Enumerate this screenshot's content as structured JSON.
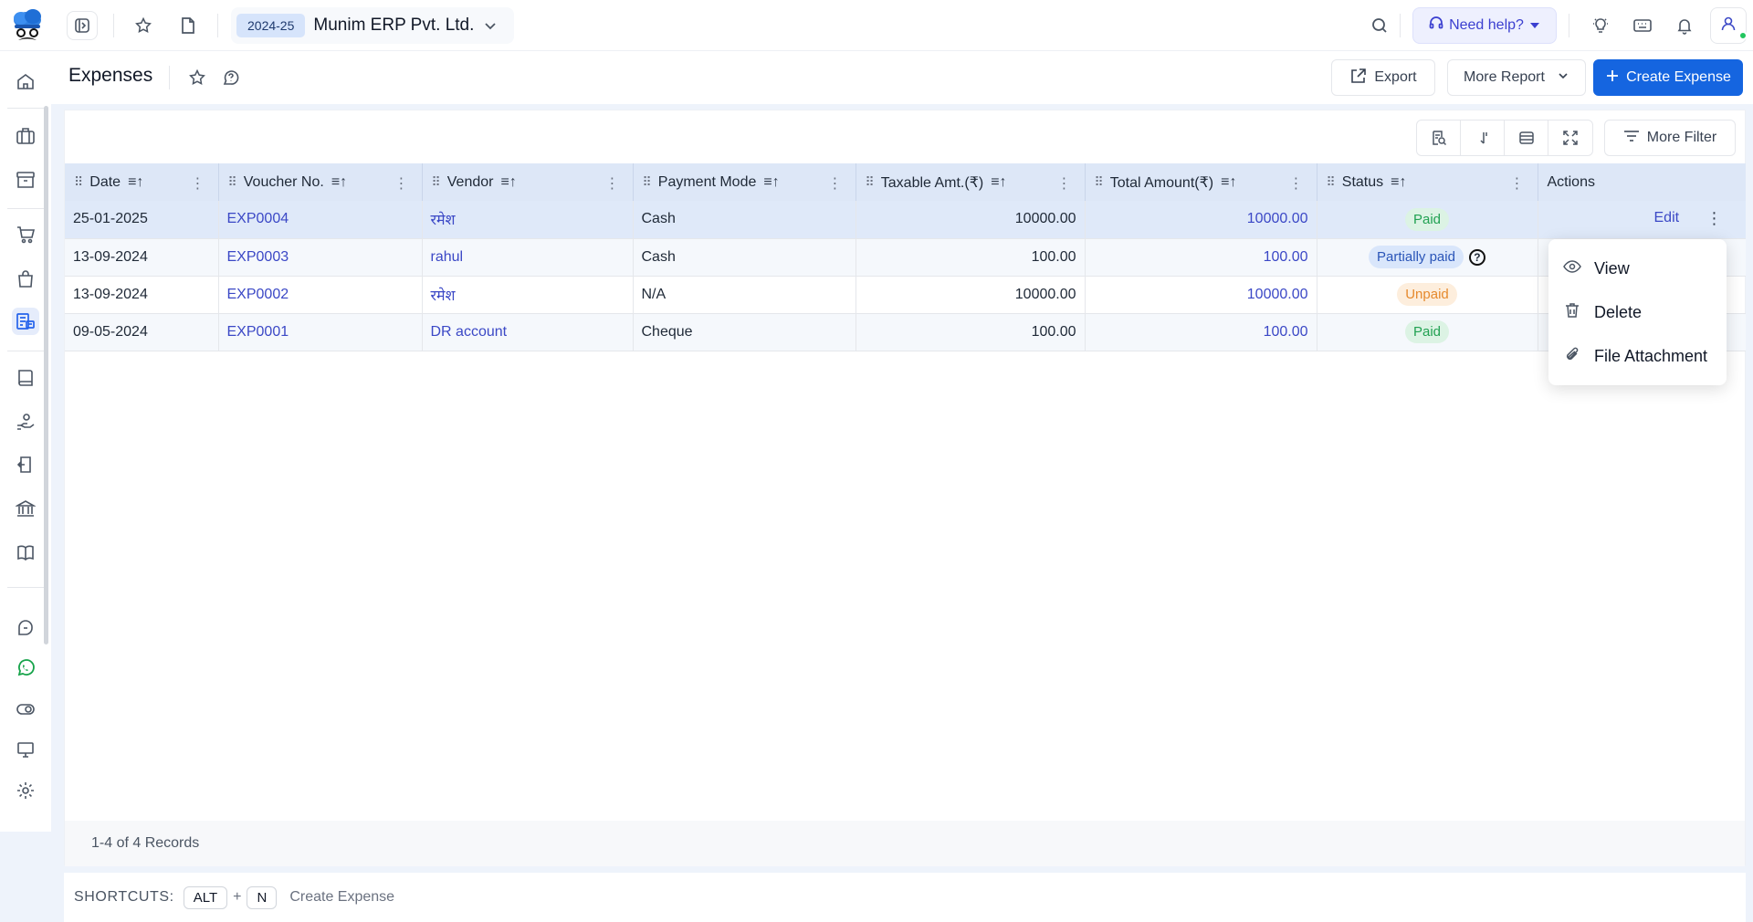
{
  "topbar": {
    "fy": "2024-25",
    "company": "Munim ERP Pvt. Ltd.",
    "help": "Need help?"
  },
  "page": {
    "title": "Expenses",
    "export": "Export",
    "more_report": "More Report",
    "create": "Create Expense",
    "more_filter": "More Filter"
  },
  "table": {
    "columns": [
      "Date",
      "Voucher No.",
      "Vendor",
      "Payment Mode",
      "Taxable Amt.(₹)",
      "Total Amount(₹)",
      "Status",
      "Actions"
    ],
    "rows": [
      {
        "date": "25-01-2025",
        "voucher": "EXP0004",
        "vendor": "रमेश",
        "mode": "Cash",
        "taxable": "10000.00",
        "total": "10000.00",
        "status": "Paid"
      },
      {
        "date": "13-09-2024",
        "voucher": "EXP0003",
        "vendor": "rahul",
        "mode": "Cash",
        "taxable": "100.00",
        "total": "100.00",
        "status": "Partially paid"
      },
      {
        "date": "13-09-2024",
        "voucher": "EXP0002",
        "vendor": "रमेश",
        "mode": "N/A",
        "taxable": "10000.00",
        "total": "10000.00",
        "status": "Unpaid"
      },
      {
        "date": "09-05-2024",
        "voucher": "EXP0001",
        "vendor": "DR account",
        "mode": "Cheque",
        "taxable": "100.00",
        "total": "100.00",
        "status": "Paid"
      }
    ],
    "edit_label": "Edit",
    "help_glyph": "?"
  },
  "menu": {
    "view": "View",
    "delete": "Delete",
    "attachment": "File Attachment"
  },
  "records": "1-4 of 4 Records",
  "shortcuts": {
    "label": "SHORTCUTS:",
    "key1": "ALT",
    "plus": "+",
    "key2": "N",
    "action": "Create Expense"
  },
  "colors": {
    "primary": "#1565e0",
    "link": "#3b48c6",
    "paid": "#21a152",
    "unpaid": "#e68a2e"
  }
}
